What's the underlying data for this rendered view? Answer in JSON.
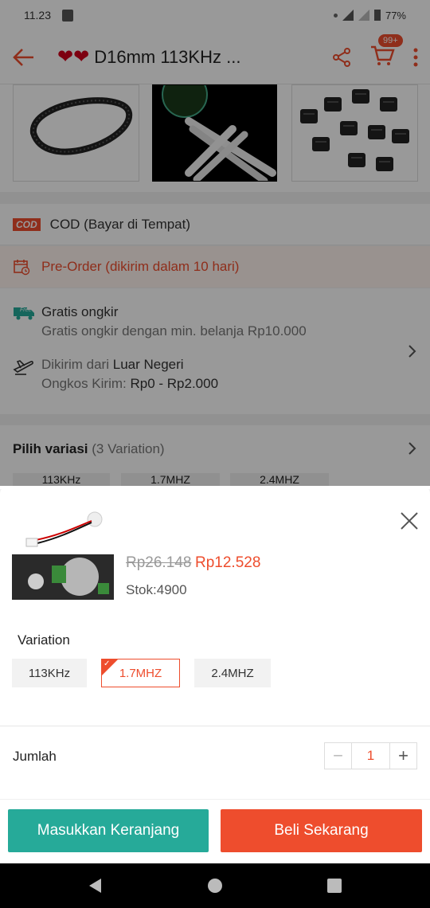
{
  "status_bar": {
    "time": "11.23",
    "battery": "77%"
  },
  "header": {
    "title": "D16mm 113KHz ...",
    "hearts": "❤❤",
    "cart_badge": "99+"
  },
  "shipping": {
    "cod_badge": "COD",
    "cod_text": "COD (Bayar di Tempat)",
    "preorder_text": "Pre-Order (dikirim dalam 10 hari)",
    "free_badge": "Free",
    "free_title": "Gratis ongkir",
    "free_sub": "Gratis ongkir dengan min. belanja Rp10.000",
    "from_label": "Dikirim dari",
    "from_value": "Luar Negeri",
    "cost_label": "Ongkos Kirim:",
    "cost_value": "Rp0 - Rp2.000"
  },
  "variation_section": {
    "title": "Pilih variasi",
    "count": "(3 Variation)",
    "chips": [
      "113KHz",
      "1.7MHZ",
      "2.4MHZ"
    ]
  },
  "sheet": {
    "price_old": "Rp26.148",
    "price_new": "Rp12.528",
    "stock": "Stok:4900",
    "variation_label": "Variation",
    "options": [
      {
        "label": "113KHz",
        "selected": false
      },
      {
        "label": "1.7MHZ",
        "selected": true
      },
      {
        "label": "2.4MHZ",
        "selected": false
      }
    ],
    "quantity_label": "Jumlah",
    "quantity": "1",
    "minus": "−",
    "plus": "+",
    "add_to_cart": "Masukkan Keranjang",
    "buy_now": "Beli Sekarang"
  },
  "colors": {
    "accent": "#ee4d2d",
    "teal": "#26aa99"
  }
}
